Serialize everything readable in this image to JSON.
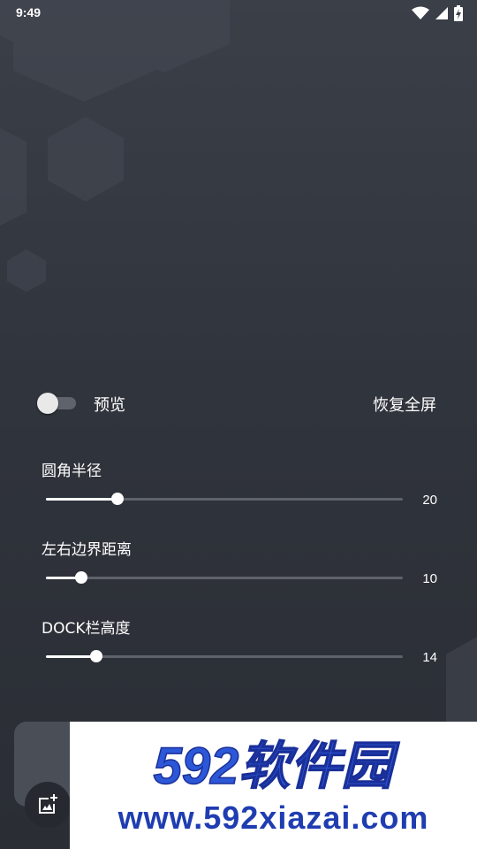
{
  "status_bar": {
    "time": "9:49",
    "icons": [
      "wifi-icon",
      "cell-signal-icon",
      "battery-charging-icon"
    ]
  },
  "preview": {
    "label": "预览",
    "toggle_on": false
  },
  "restore_fullscreen_label": "恢复全屏",
  "sliders": [
    {
      "label": "圆角半径",
      "value": "20",
      "fraction": 0.2
    },
    {
      "label": "左右边界距离",
      "value": "10",
      "fraction": 0.1
    },
    {
      "label": "DOCK栏高度",
      "value": "14",
      "fraction": 0.14
    }
  ],
  "fab": {
    "icon": "add-image-icon"
  },
  "watermark": {
    "logo_text": "592软件园",
    "url": "www.592xiazai.com",
    "colors": {
      "blue": "#2c58d8",
      "navy": "#1a2f99"
    }
  }
}
